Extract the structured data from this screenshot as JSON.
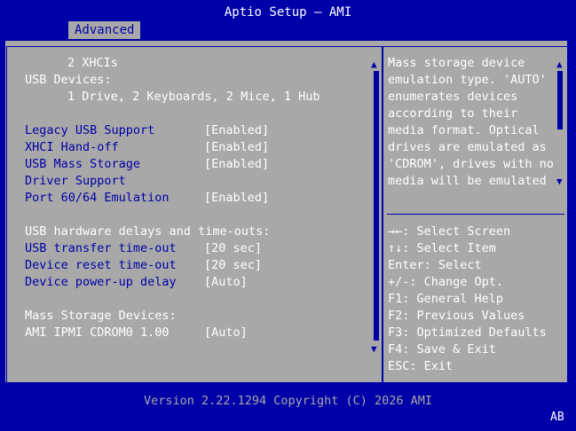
{
  "window": {
    "title": "Aptio Setup – AMI"
  },
  "tabs": [
    {
      "label": "Advanced"
    }
  ],
  "info": {
    "xhci_count": "2 XHCIs",
    "usb_devices_label": "USB Devices:",
    "usb_devices_value": "1 Drive, 2 Keyboards, 2 Mice, 1 Hub"
  },
  "settings": [
    {
      "label": "Legacy USB Support",
      "value": "[Enabled]"
    },
    {
      "label": "XHCI Hand-off",
      "value": "[Enabled]"
    },
    {
      "label": "USB Mass Storage",
      "value": "[Enabled]"
    },
    {
      "label": "Driver Support",
      "value": ""
    },
    {
      "label": "Port 60/64 Emulation",
      "value": "[Enabled]"
    }
  ],
  "delays": {
    "heading": "USB hardware delays and time-outs:",
    "items": [
      {
        "label": "USB transfer time-out",
        "value": "[20 sec]"
      },
      {
        "label": "Device reset time-out",
        "value": "[20 sec]"
      },
      {
        "label": "Device power-up delay",
        "value": "[Auto]"
      }
    ]
  },
  "mass_storage": {
    "heading": "Mass Storage Devices:",
    "selected": {
      "label": "AMI IPMI CDROM0 1.00",
      "value": "[Auto]"
    }
  },
  "help_text": [
    "Mass storage device",
    "emulation type. 'AUTO'",
    "enumerates devices",
    "according to their",
    "media format. Optical",
    "drives are emulated as",
    "'CDROM', drives with no",
    "media will be emulated"
  ],
  "key_help": [
    "→←: Select Screen",
    "↑↓: Select Item",
    "Enter: Select",
    "+/-: Change Opt.",
    "F1: General Help",
    "F2: Previous Values",
    "F3: Optimized Defaults",
    "F4: Save & Exit",
    "ESC: Exit"
  ],
  "footer": {
    "version": "Version 2.22.1294 Copyright (C) 2026 AMI",
    "badge": "AB"
  },
  "colors": {
    "background": "#0000a8",
    "panel": "#a8a8a8",
    "text": "#ffffff",
    "accent": "#0000a8"
  }
}
